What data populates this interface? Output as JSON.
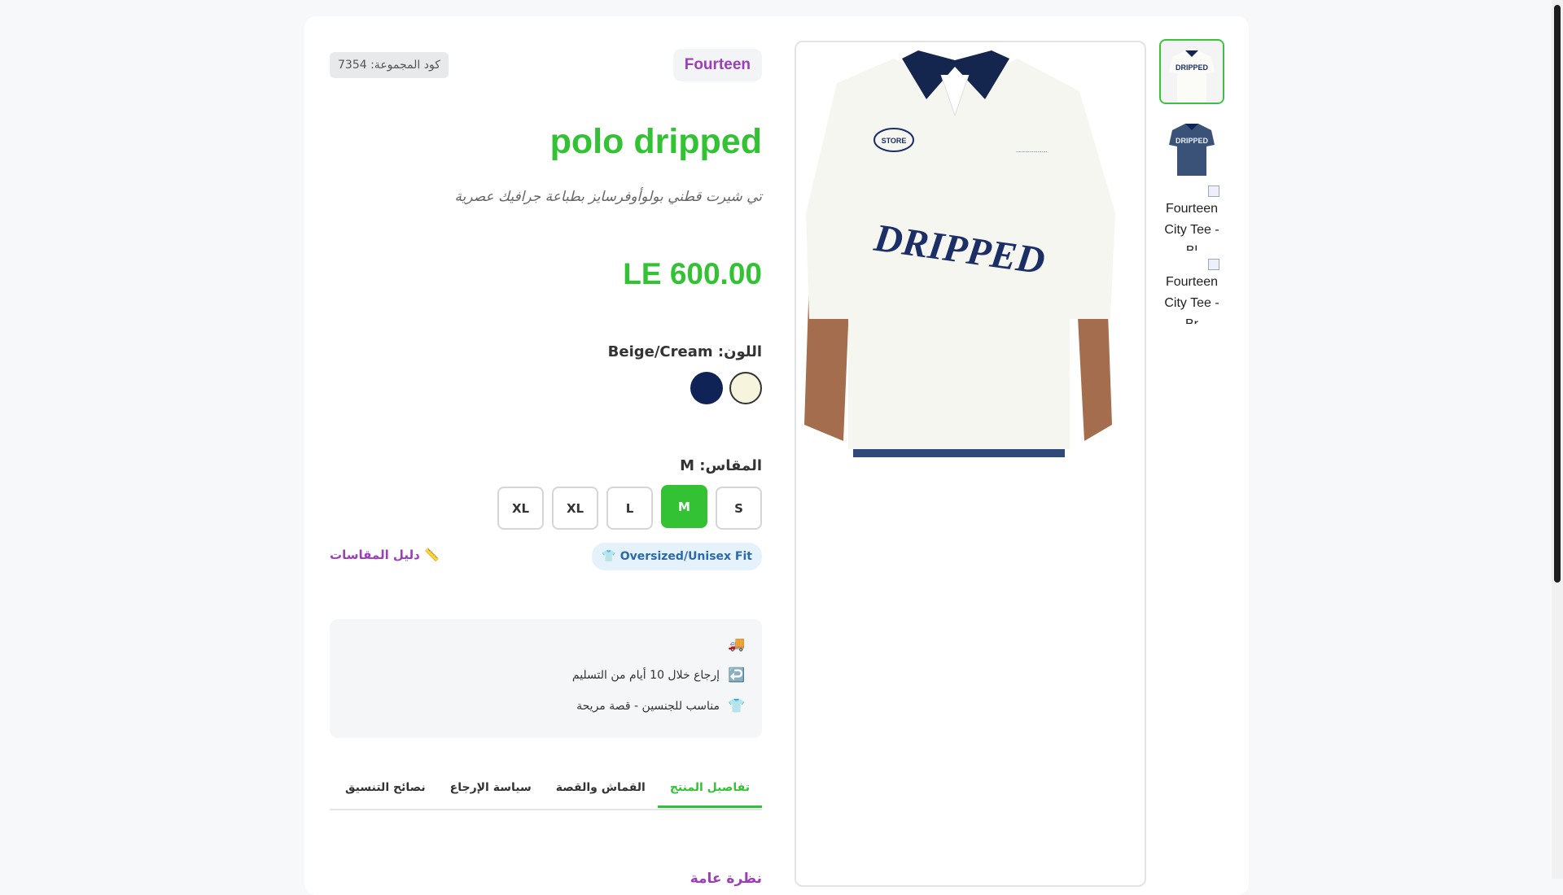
{
  "brand": "Fourteen",
  "group_code": "كود المجموعة: 7354",
  "product_title": "polo dripped",
  "subtitle": "تي شيرت قطني بولوأوفرسايز بطباعة جرافيك عصرية",
  "price": "LE 600.00",
  "color": {
    "label": "اللون: Beige/Cream",
    "swatches": [
      {
        "name": "beige-cream",
        "hex": "#f6f4dc",
        "selected": true
      },
      {
        "name": "navy",
        "hex": "#0f2356",
        "selected": false
      }
    ]
  },
  "size": {
    "label": "المقاس: M",
    "options": [
      "S",
      "M",
      "L",
      "XL",
      "XL"
    ],
    "selected": "M"
  },
  "fit_badge": "👕 Oversized/Unisex Fit",
  "size_guide": "📏 دليل المقاسات",
  "benefits": [
    {
      "icon": "🚚",
      "text": ""
    },
    {
      "icon": "↩️",
      "text": "إرجاع خلال 10 أيام من التسليم"
    },
    {
      "icon": "👕",
      "text": "مناسب للجنسين - قصة مريحة"
    }
  ],
  "tabs": [
    "تفاصيل المنتج",
    "القماش والقصة",
    "سياسة الإرجاع",
    "نصائح التنسيق"
  ],
  "active_tab": "تفاصيل المنتج",
  "tab_content_title": "نظرة عامة",
  "thumbnails": {
    "broken_1": "Fourteen City Tee - Bl",
    "broken_2": "Fourteen City Tee - Br"
  },
  "image_text": {
    "print": "DRIPPED"
  },
  "colors": {
    "accent_green": "#33c233",
    "brand_purple": "#9b3fb8"
  }
}
